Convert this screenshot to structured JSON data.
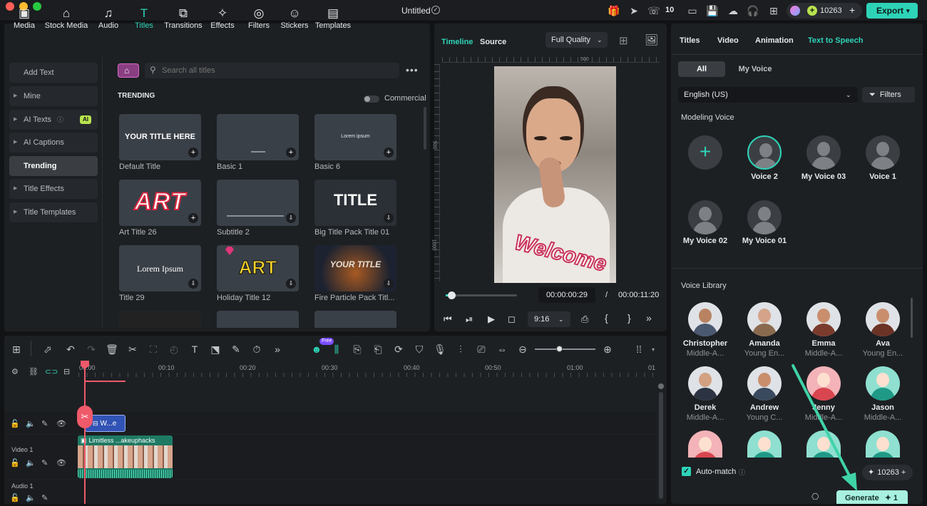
{
  "window": {
    "title": "Untitled",
    "badge_count": "10",
    "credits": "10263",
    "export_label": "Export"
  },
  "media_tabs": [
    {
      "label": "Media",
      "icon": "media-icon"
    },
    {
      "label": "Stock Media",
      "icon": "stock-media-icon"
    },
    {
      "label": "Audio",
      "icon": "audio-icon"
    },
    {
      "label": "Titles",
      "icon": "titles-icon"
    },
    {
      "label": "Transitions",
      "icon": "transitions-icon"
    },
    {
      "label": "Effects",
      "icon": "effects-icon"
    },
    {
      "label": "Filters",
      "icon": "filters-icon"
    },
    {
      "label": "Stickers",
      "icon": "stickers-icon"
    },
    {
      "label": "Templates",
      "icon": "templates-icon"
    }
  ],
  "sidebar": {
    "items": [
      {
        "label": "Add Text"
      },
      {
        "label": "Mine"
      },
      {
        "label": "AI Texts",
        "badge": "AI"
      },
      {
        "label": "AI Captions"
      },
      {
        "label": "Trending"
      },
      {
        "label": "Title Effects"
      },
      {
        "label": "Title Templates"
      }
    ]
  },
  "search": {
    "placeholder": "Search all titles"
  },
  "trending": {
    "heading": "TRENDING",
    "commercial_label": "Commercial"
  },
  "title_cards": [
    {
      "label": "Default Title",
      "preview": "YOUR TITLE HERE"
    },
    {
      "label": "Basic 1",
      "preview": ""
    },
    {
      "label": "Basic 6",
      "preview": "Lorem ipsum"
    },
    {
      "label": "Art Title 26",
      "preview": "ART"
    },
    {
      "label": "Subtitle 2",
      "preview": ""
    },
    {
      "label": "Big Title Pack Title 01",
      "preview": "TITLE"
    },
    {
      "label": "Title 29",
      "preview": "Lorem Ipsum"
    },
    {
      "label": "Holiday Title 12",
      "preview": "ART"
    },
    {
      "label": "Fire Particle Pack Titl...",
      "preview": "YOUR TITLE"
    }
  ],
  "preview": {
    "tab_timeline": "Timeline",
    "tab_source": "Source",
    "quality": "Full Quality",
    "ruler_top_mark": "500",
    "ruler_left_mark1": "500",
    "ruler_left_mark2": "1000",
    "overlay_text": "Welcome",
    "current_time": "00:00:00:29",
    "separator": "/",
    "total_time": "00:00:11:20",
    "aspect": "9:16"
  },
  "right_panel": {
    "tabs": [
      "Titles",
      "Video",
      "Animation",
      "Text to Speech"
    ],
    "filter_all": "All",
    "filter_my_voice": "My Voice",
    "language": "English (US)",
    "filters_label": "Filters",
    "modeling_heading": "Modeling Voice",
    "modeling_voices": [
      "Voice 2",
      "My Voice 03",
      "Voice 1",
      "My Voice 02",
      "My Voice 01"
    ],
    "library_heading": "Voice Library",
    "library_voices": [
      {
        "name": "Christopher",
        "sub": "Middle-A..."
      },
      {
        "name": "Amanda",
        "sub": "Young En..."
      },
      {
        "name": "Emma",
        "sub": "Middle-A..."
      },
      {
        "name": "Ava",
        "sub": "Young En..."
      },
      {
        "name": "Derek",
        "sub": "Middle-A..."
      },
      {
        "name": "Andrew",
        "sub": "Young C..."
      },
      {
        "name": "Jenny",
        "sub": "Middle-A..."
      },
      {
        "name": "Jason",
        "sub": "Middle-A..."
      }
    ],
    "auto_match": "Auto-match",
    "credits": "10263",
    "generate_label": "Generate",
    "generate_cost": "1"
  },
  "timeline": {
    "ticks": [
      "00:00",
      "00:10",
      "00:20",
      "00:30",
      "00:40",
      "00:50",
      "01:00",
      "01"
    ],
    "title_clip": "W...e",
    "video_clip": "Limitless ...akeuphacks",
    "track_video": "Video 1",
    "track_audio": "Audio 1",
    "new_badge": "Free"
  },
  "colors": {
    "accent": "#2ed3b7",
    "pink": "#e94b6a",
    "panel": "#1d2023"
  }
}
